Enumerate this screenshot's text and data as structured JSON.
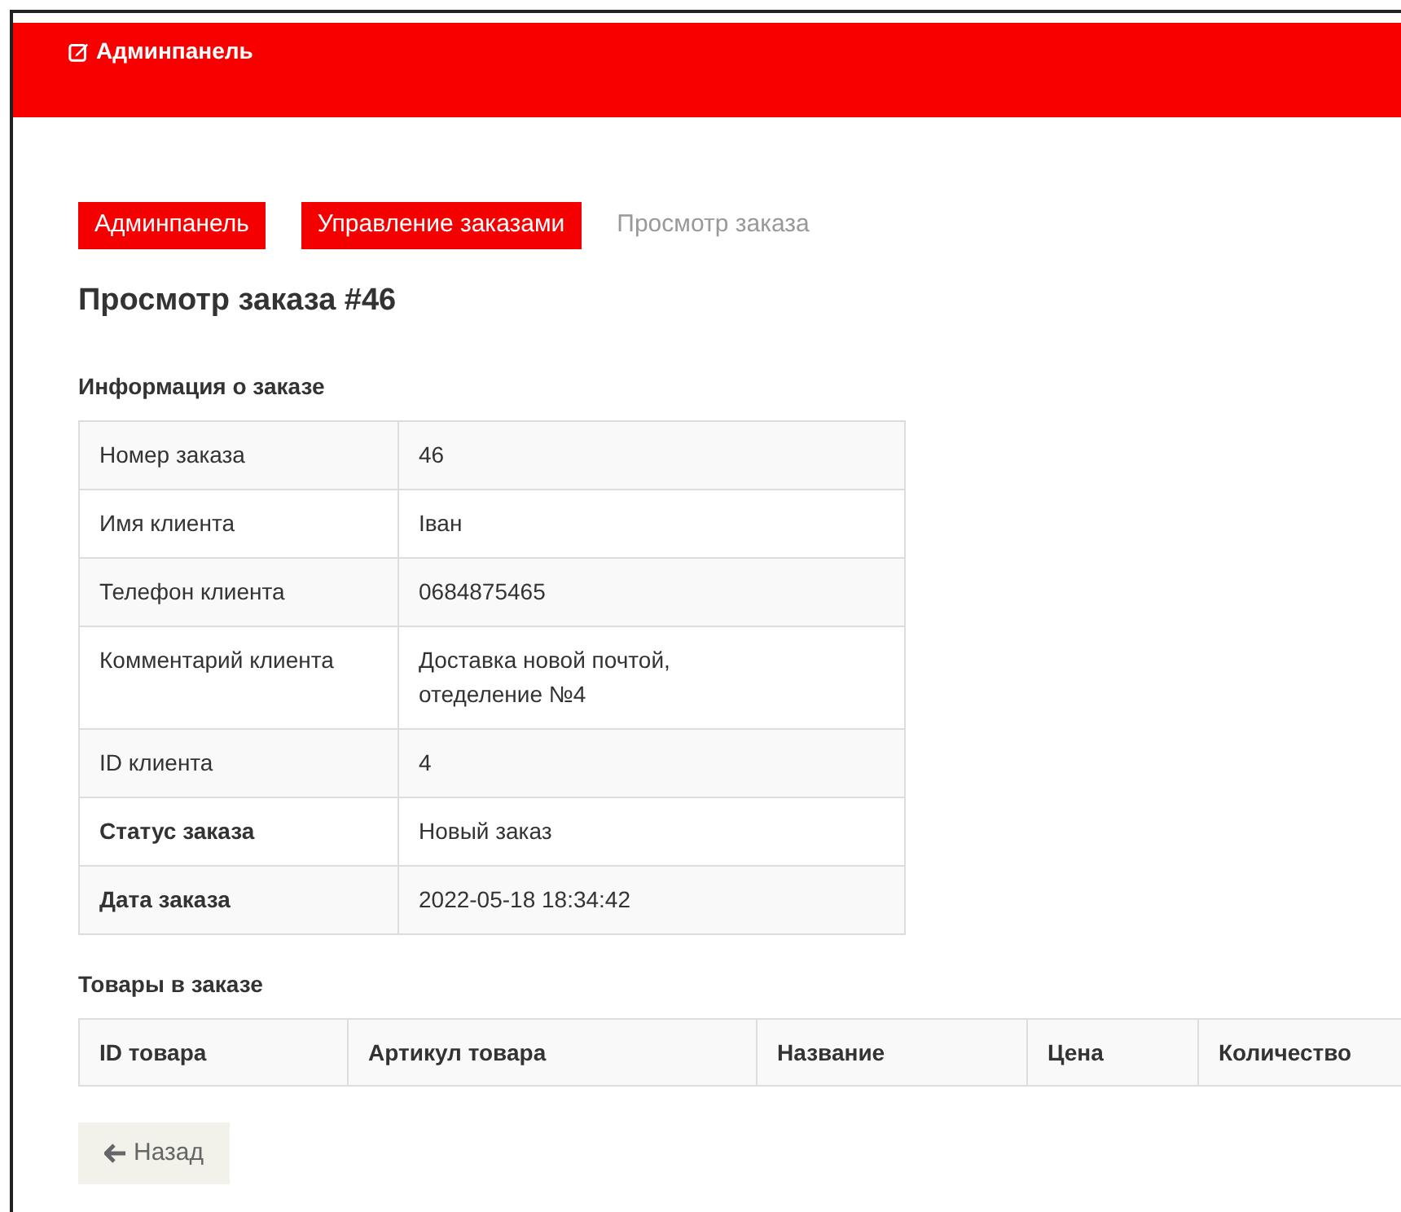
{
  "navbar": {
    "brand": "Админпанель"
  },
  "breadcrumbs": [
    {
      "label": "Админпанель",
      "current": false
    },
    {
      "label": "Управление заказами",
      "current": false
    },
    {
      "label": "Просмотр заказа",
      "current": true
    }
  ],
  "title": "Просмотр заказа #46",
  "order_info": {
    "heading": "Информация о заказе",
    "rows": [
      {
        "label": "Номер заказа",
        "value": "46",
        "bold": false
      },
      {
        "label": "Имя клиента",
        "value": "Іван",
        "bold": false
      },
      {
        "label": "Телефон клиента",
        "value": "0684875465",
        "bold": false
      },
      {
        "label": "Комментарий клиента",
        "value": "Доставка новой почтой, отеделение №4",
        "bold": false
      },
      {
        "label": "ID клиента",
        "value": "4",
        "bold": false
      },
      {
        "label": "Статус заказа",
        "value": "Новый заказ",
        "bold": true
      },
      {
        "label": "Дата заказа",
        "value": "2022-05-18 18:34:42",
        "bold": true
      }
    ]
  },
  "products": {
    "heading": "Товары в заказе",
    "columns": [
      "ID товара",
      "Артикул товара",
      "Название",
      "Цена",
      "Количество"
    ]
  },
  "back_button": {
    "label": "Назад"
  }
}
